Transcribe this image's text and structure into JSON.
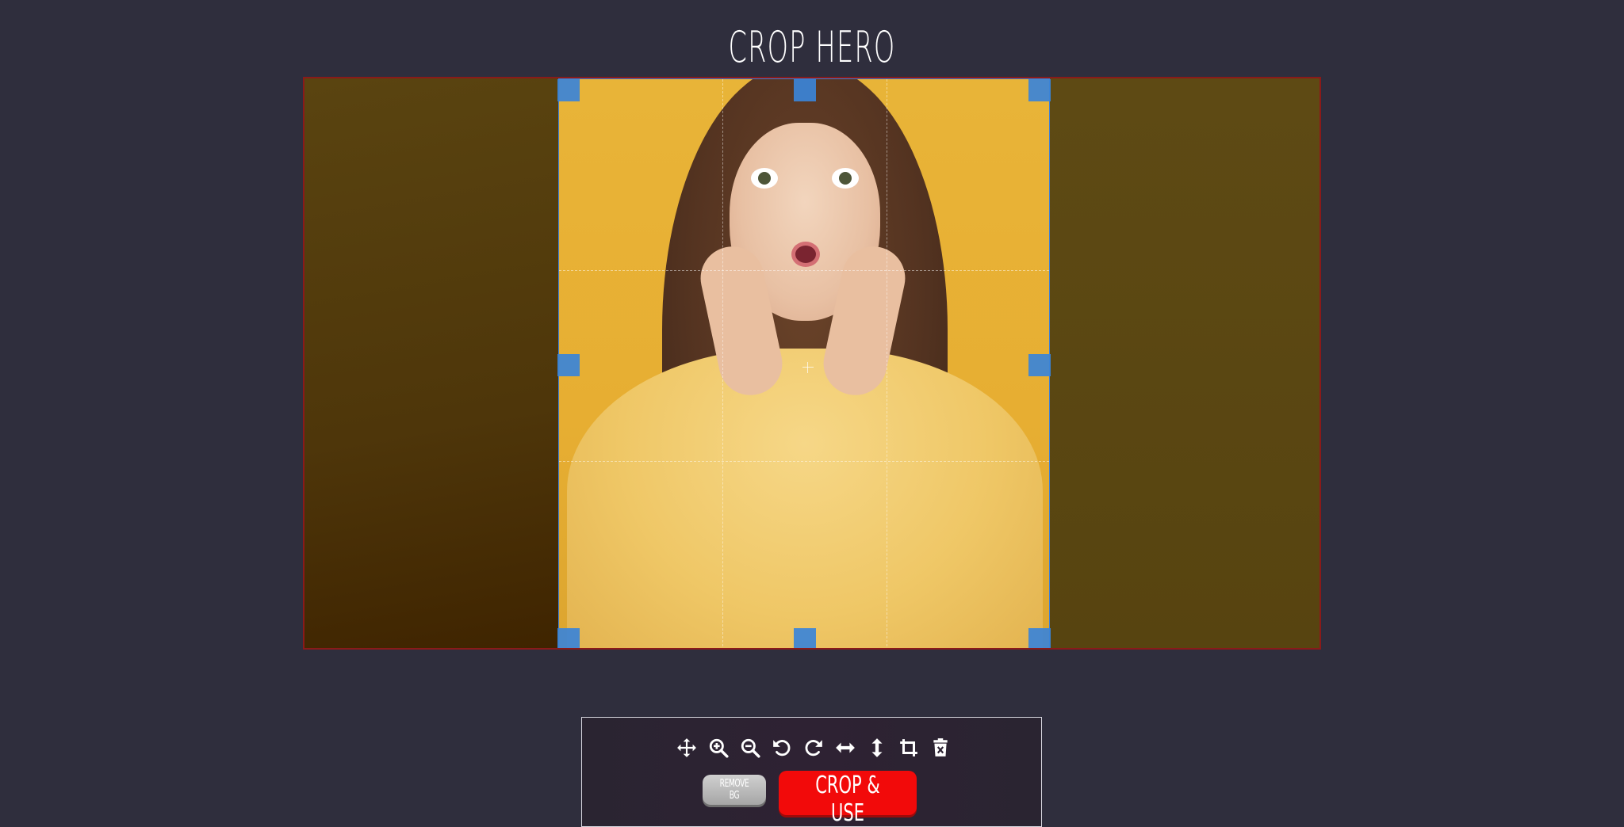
{
  "app": {
    "title": "CROP HERO"
  },
  "toolbar": {
    "tools": [
      {
        "icon": "move-icon"
      },
      {
        "icon": "zoom-in-icon"
      },
      {
        "icon": "zoom-out-icon"
      },
      {
        "icon": "rotate-left-icon"
      },
      {
        "icon": "rotate-right-icon"
      },
      {
        "icon": "flip-horizontal-icon"
      },
      {
        "icon": "flip-vertical-icon"
      },
      {
        "icon": "crop-icon"
      },
      {
        "icon": "delete-icon"
      }
    ],
    "remove_bg_label": "REMOVE BG",
    "crop_use_label": "CROP & USE"
  },
  "colors": {
    "background": "#2f2e3d",
    "handle": "#3b84d8",
    "crop_button": "#f20a0a",
    "stage_border": "#8a1a1a"
  }
}
